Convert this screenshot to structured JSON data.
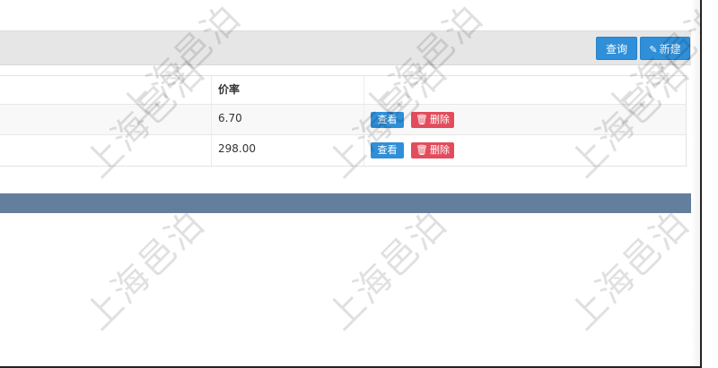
{
  "toolbar": {
    "query_label": "查询",
    "new_label": "新建",
    "new_icon": "pencil-icon"
  },
  "table": {
    "columns": [
      "价率"
    ],
    "rows": [
      {
        "rate": "6.70",
        "view_label": "查看",
        "delete_label": "删除"
      },
      {
        "rate": "298.00",
        "view_label": "查看",
        "delete_label": "删除"
      }
    ]
  },
  "icons": {
    "edit": "pencil-icon",
    "delete": "trash-icon"
  },
  "colors": {
    "primary": "#2f8fd8",
    "danger": "#e24c5c",
    "footer_bar": "#647e9e",
    "toolbar_bg": "#e6e6e6"
  },
  "watermark": {
    "text": "上海邑泊"
  }
}
